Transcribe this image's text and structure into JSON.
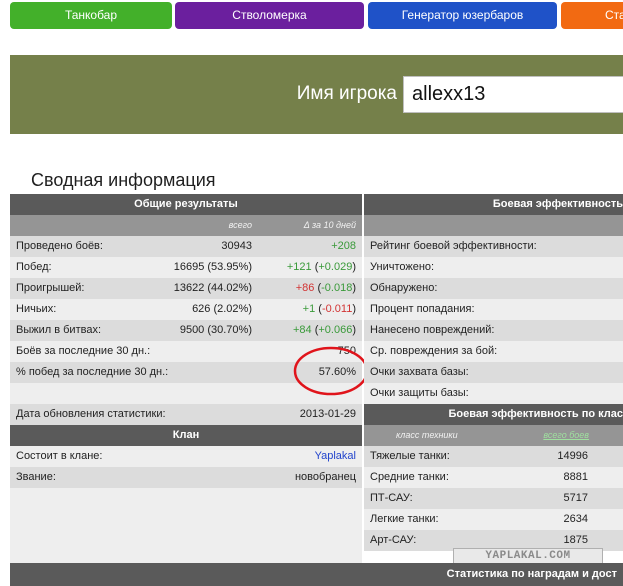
{
  "nav": {
    "tabs": [
      {
        "label": "Танкобар",
        "color": "#43b02a"
      },
      {
        "label": "Стволомерка",
        "color": "#6b1f9e"
      },
      {
        "label": "Генератор юзербаров",
        "color": "#1f52c8"
      },
      {
        "label": "Ста",
        "color": "#f26a12"
      }
    ]
  },
  "header": {
    "player_label": "Имя игрока",
    "player_value": "allexx13",
    "band_color": "#75804a"
  },
  "summary": {
    "title": "Сводная информация",
    "general": {
      "header": "Общие результаты",
      "col_total": "всего",
      "col_delta": "Δ за 10 дней",
      "rows": [
        {
          "label": "Проведено боёв:",
          "total": "30943",
          "delta": "+208",
          "delta_extra": ""
        },
        {
          "label": "Побед:",
          "total": "16695 (53.95%)",
          "delta": "+121",
          "delta_extra": "+0.029"
        },
        {
          "label": "Проигрышей:",
          "total": "13622 (44.02%)",
          "delta": "+86",
          "delta_extra": "-0.018"
        },
        {
          "label": "Ничьих:",
          "total": "626 (2.02%)",
          "delta": "+1",
          "delta_extra": "-0.011"
        },
        {
          "label": "Выжил в битвах:",
          "total": "9500 (30.70%)",
          "delta": "+84",
          "delta_extra": "+0.066"
        },
        {
          "label": "Боёв за последние 30 дн.:",
          "total": "750",
          "delta": "",
          "delta_extra": ""
        },
        {
          "label": "% побед за последние 30 дн.:",
          "total": "57.60%",
          "delta": "",
          "delta_extra": ""
        },
        {
          "label": "",
          "total": "",
          "delta": "",
          "delta_extra": ""
        },
        {
          "label": "Дата обновления статистики:",
          "total": "2013-01-29",
          "delta": "",
          "delta_extra": ""
        }
      ]
    },
    "clan": {
      "header": "Клан",
      "rows": [
        {
          "label": "Состоит в клане:",
          "value": "Yaplakal"
        },
        {
          "label": "Звание:",
          "value": "новобранец"
        }
      ]
    },
    "efficiency": {
      "header": "Боевая эффективность",
      "rows": [
        {
          "label": ""
        },
        {
          "label": "Рейтинг боевой эффективности:"
        },
        {
          "label": "Уничтожено:"
        },
        {
          "label": "Обнаружено:"
        },
        {
          "label": "Процент попадания:"
        },
        {
          "label": "Нанесено повреждений:"
        },
        {
          "label": "Ср. повреждения за бой:"
        },
        {
          "label": "Очки захвата базы:"
        },
        {
          "label": "Очки защиты базы:"
        }
      ]
    },
    "by_class": {
      "header": "Боевая эффективность по клас",
      "col_class": "класс техники",
      "col_total": "всего боев",
      "rows": [
        {
          "label": "Тяжелые танки:",
          "value": "14996"
        },
        {
          "label": "Средние танки:",
          "value": "8881"
        },
        {
          "label": "ПТ-САУ:",
          "value": "5717"
        },
        {
          "label": "Легкие танки:",
          "value": "2634"
        },
        {
          "label": "Арт-САУ:",
          "value": "1875"
        }
      ]
    }
  },
  "footer": {
    "label": "Статистика по наградам и дост"
  },
  "watermark": "YAPLAKAL.COM"
}
